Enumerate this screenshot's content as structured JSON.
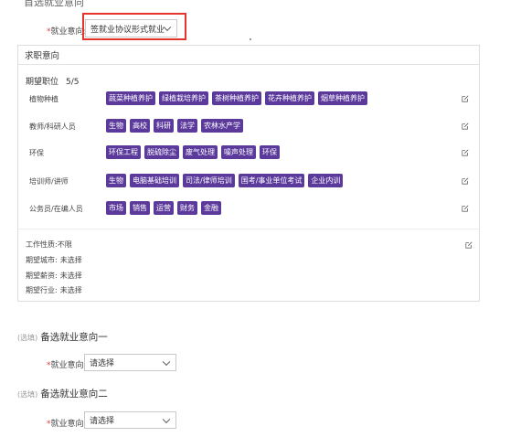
{
  "top_heading": "首选就业意向",
  "primary": {
    "required_mark": "*",
    "label": "就业意向:",
    "selected": "签就业协议形式就业"
  },
  "card": {
    "title": "求职意向",
    "positions_label": "期望职位",
    "positions_count": "5/5",
    "categories": [
      {
        "name": "植物种植",
        "tags": [
          "蔬菜种植养护",
          "绿植栽培养护",
          "茶树种植养护",
          "花卉种植养护",
          "烟草种植养护"
        ]
      },
      {
        "name": "教师/科研人员",
        "tags": [
          "生物",
          "高校",
          "科研",
          "法学",
          "农林水产学"
        ]
      },
      {
        "name": "环保",
        "tags": [
          "环保工程",
          "脱硫除尘",
          "废气处理",
          "噪声处理",
          "环保"
        ]
      },
      {
        "name": "培训师/讲师",
        "tags": [
          "生物",
          "电脑基础培训",
          "司法/律师培训",
          "国考/事业单位考试",
          "企业内训"
        ]
      },
      {
        "name": "公务员/在编人员",
        "tags": [
          "市场",
          "销售",
          "运营",
          "财务",
          "金融"
        ]
      }
    ],
    "work_nature": {
      "label": "工作性质:",
      "value": "不限"
    },
    "city": {
      "label": "期望城市:",
      "value": "未选择"
    },
    "salary": {
      "label": "期望薪资:",
      "value": "未选择"
    },
    "industry": {
      "label": "期望行业:",
      "value": "未选择"
    }
  },
  "alt1": {
    "optional_tag": "(选填)",
    "title": "备选就业意向一",
    "required_mark": "*",
    "label": "就业意向:",
    "selected": "请选择"
  },
  "alt2": {
    "optional_tag": "(选填)",
    "title": "备选就业意向二",
    "required_mark": "*",
    "label": "就业意向:",
    "selected": "请选择"
  },
  "colors": {
    "tag": "#5b3a9c",
    "highlight": "#e5342c"
  }
}
